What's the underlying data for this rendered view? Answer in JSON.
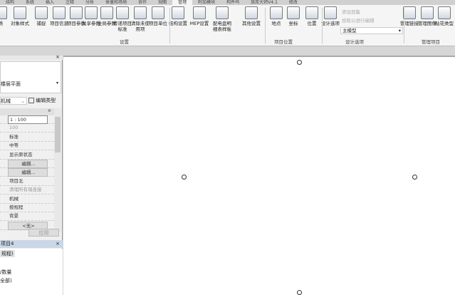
{
  "tabs": [
    "结构",
    "系统",
    "插入",
    "注释",
    "分析",
    "体量和场地",
    "协作",
    "视图",
    "管理",
    "附加模块",
    "构件坞",
    "族库大师V4.1",
    "修改"
  ],
  "active_tab": "管理",
  "ribbon": {
    "tools": [
      "对象样式",
      "捕捉",
      "项目信息",
      "项目参数",
      "共享参数",
      "全局参数",
      "传递项目标准",
      "清除未使用项",
      "项目单位",
      "结构设置",
      "MEP设置",
      "配电盘明细表样板",
      "其他设置",
      "地点",
      "坐标",
      "位置",
      "设计选项",
      "管理链接",
      "管理图像",
      "贴花类型"
    ],
    "partial_tool": "质",
    "groups": [
      "设置",
      "项目位置",
      "设计选项",
      "管理项目"
    ],
    "add_to_set": "添加到集",
    "pick_to_edit": "拾取以进行编辑",
    "design_option_value": "主模型"
  },
  "properties": {
    "type_name": "楼层平面",
    "view_selector": "机械",
    "edit_type": "编辑类型",
    "values": [
      "1 : 100",
      "100",
      "标准",
      "中等",
      "显示原状态",
      "编辑...",
      "编辑...",
      "项目北",
      "清理所有墙连接",
      "机械",
      "按规程",
      "背景",
      "<无>"
    ],
    "apply": "应用"
  },
  "browser": {
    "title": "项目4",
    "items": [
      "规程)",
      "/数量",
      "全部)"
    ]
  }
}
